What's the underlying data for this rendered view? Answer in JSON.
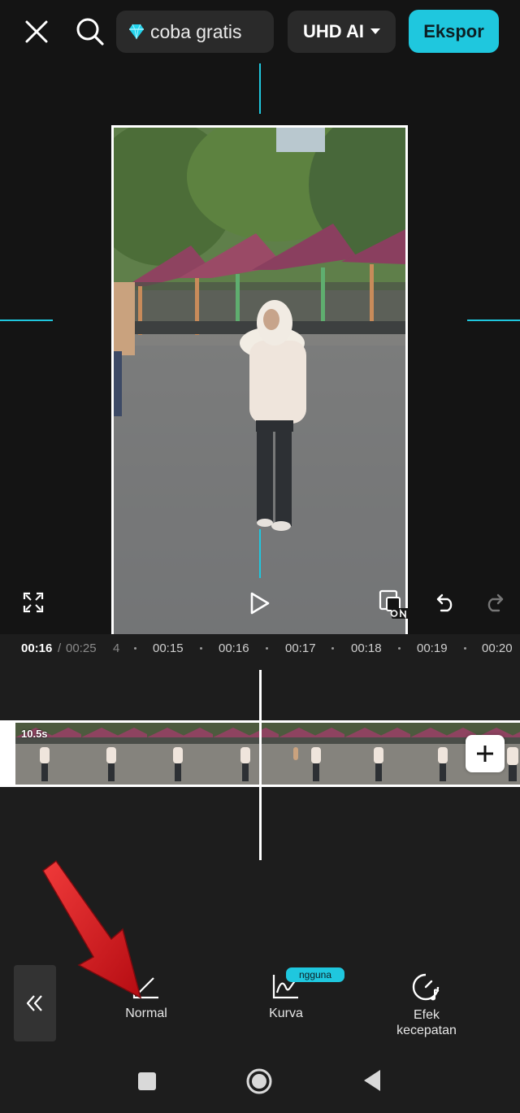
{
  "header": {
    "trial_label": "coba gratis",
    "quality_label": "UHD AI",
    "export_label": "Ekspor"
  },
  "timeline": {
    "current_time": "00:16",
    "separator": "/",
    "total_time": "00:25",
    "ruler_ticks": [
      "4",
      "00:15",
      "00:16",
      "00:17",
      "00:18",
      "00:19",
      "00:20"
    ],
    "clip_duration": "10.5s"
  },
  "toolbar": {
    "normal_label": "Normal",
    "curve_label": "Kurva",
    "curve_badge": "ngguna",
    "speed_label_line1": "Efek",
    "speed_label_line2": "kecepatan"
  },
  "colors": {
    "accent": "#1fc7de",
    "background": "#141414",
    "panel": "#1d1d1d",
    "annotation_arrow": "#d8151b"
  },
  "icons": {
    "close": "close-icon",
    "search": "search-icon",
    "diamond": "diamond-icon",
    "caret": "caret-down-icon",
    "fullscreen": "fullscreen-icon",
    "play": "play-icon",
    "keyframe": "keyframe-on-icon",
    "undo": "undo-icon",
    "redo": "redo-icon",
    "add": "plus-icon",
    "back": "double-chevron-left-icon",
    "normal": "normal-speed-icon",
    "curve": "curve-speed-icon",
    "speed_effect": "speed-effect-icon"
  }
}
